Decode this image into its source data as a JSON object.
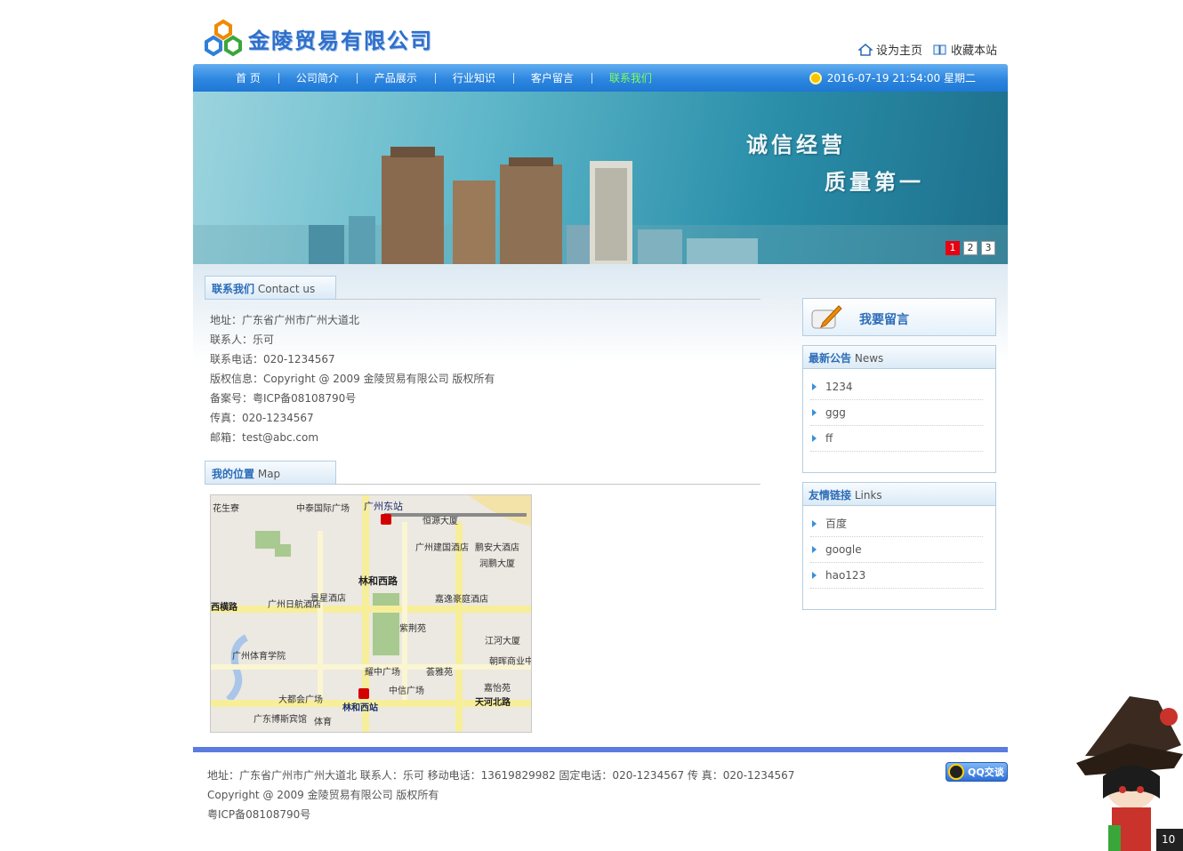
{
  "header": {
    "company_name": "金陵贸易有限公司",
    "set_home": "设为主页",
    "bookmark": "收藏本站"
  },
  "nav": {
    "items": [
      "首 页",
      "公司简介",
      "产品展示",
      "行业知识",
      "客户留言",
      "联系我们"
    ],
    "active": "联系我们",
    "datetime": "2016-07-19 21:54:00 星期二"
  },
  "banner": {
    "slogan_line1": "诚信经营",
    "slogan_line2": "质量第一",
    "pages": [
      "1",
      "2",
      "3"
    ],
    "active_page": "1"
  },
  "contact": {
    "title_cn": "联系我们",
    "title_en": "Contact us",
    "lines": [
      "地址：广东省广州市广州大道北",
      "联系人：乐可",
      "联系电话：020-1234567",
      "版权信息：Copyright @ 2009 金陵贸易有限公司 版权所有",
      "备案号：粤ICP备08108790号",
      "传真：020-1234567",
      "邮箱：test@abc.com"
    ]
  },
  "location": {
    "title_cn": "我的位置",
    "title_en": "Map",
    "map_labels": [
      "花生寮",
      "中泰国际广场",
      "广州东站",
      "恒源大厦",
      "林和西路",
      "广州建国酒店",
      "鹏安大酒店",
      "润鹏大厦",
      "景星酒店",
      "广州日航酒店",
      "嘉逸豪庭酒店",
      "西横路",
      "紫荆苑",
      "江河大厦",
      "广州体育学院",
      "耀中广场",
      "荟雅苑",
      "朝晖商业中心",
      "中信广场",
      "嘉怡苑",
      "大都会广场",
      "林和西站",
      "天河北路",
      "广东博斯宾馆",
      "体育"
    ]
  },
  "sidebar": {
    "message_label": "我要留言",
    "news": {
      "title_cn": "最新公告",
      "title_en": "News",
      "items": [
        "1234",
        "ggg",
        "ff"
      ]
    },
    "links": {
      "title_cn": "友情链接",
      "title_en": "Links",
      "items": [
        "百度",
        "google",
        "hao123"
      ]
    }
  },
  "footer": {
    "line1": "地址：广东省广州市广州大道北 联系人：乐可 移动电话：13619829982 固定电话：020-1234567 传 真：020-1234567",
    "line2": "Copyright @ 2009 金陵贸易有限公司 版权所有",
    "line3": "粤ICP备08108790号",
    "qq_label": "QQ交谈"
  },
  "mascot_counter": "10",
  "colors": {
    "nav_blue": "#2d86df",
    "link_blue": "#2b6cb8",
    "active_nav": "#7dff5e",
    "footer_bar": "#5b7be0",
    "pager_active": "#e60012"
  }
}
